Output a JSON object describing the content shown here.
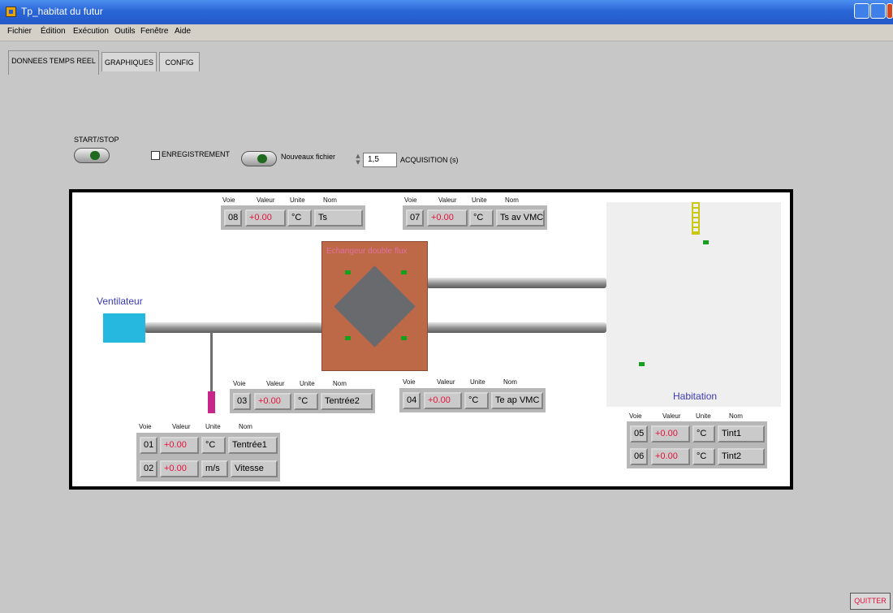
{
  "window": {
    "title": "Tp_habitat du futur"
  },
  "menu": [
    "Fichier",
    "Édition",
    "Exécution",
    "Outils",
    "Fenêtre",
    "Aide"
  ],
  "tabs": [
    "DONNEES TEMPS REEL",
    "GRAPHIQUES",
    "CONFIG"
  ],
  "controls": {
    "start_stop_label": "START/STOP",
    "enregistrement_label": "ENREGISTREMENT",
    "nouveau_fichier_label": "Nouveaux fichier",
    "acquisition_value": "1,5",
    "acquisition_label": "ACQUISITION (s)"
  },
  "diagram": {
    "ventilateur_label": "Ventilateur",
    "echangeur_label": "Echangeur double flux",
    "habitation_label": "Habitation"
  },
  "table_headers": {
    "voie": "Voie",
    "valeur": "Valeur",
    "unite": "Unite",
    "nom": "Nom"
  },
  "sensors": {
    "s08": {
      "voie": "08",
      "valeur": "+0.00",
      "unite": "°C",
      "nom": "Ts"
    },
    "s07": {
      "voie": "07",
      "valeur": "+0.00",
      "unite": "°C",
      "nom": "Ts av VMC"
    },
    "s03": {
      "voie": "03",
      "valeur": "+0.00",
      "unite": "°C",
      "nom": "Tentrée2"
    },
    "s04": {
      "voie": "04",
      "valeur": "+0.00",
      "unite": "°C",
      "nom": "Te ap VMC"
    },
    "s01": {
      "voie": "01",
      "valeur": "+0.00",
      "unite": "°C",
      "nom": "Tentrée1"
    },
    "s02": {
      "voie": "02",
      "valeur": "+0.00",
      "unite": "m/s",
      "nom": "Vitesse"
    },
    "s05": {
      "voie": "05",
      "valeur": "+0.00",
      "unite": "°C",
      "nom": "Tint1"
    },
    "s06": {
      "voie": "06",
      "valeur": "+0.00",
      "unite": "°C",
      "nom": "Tint2"
    }
  },
  "quit_label": "QUITTER"
}
